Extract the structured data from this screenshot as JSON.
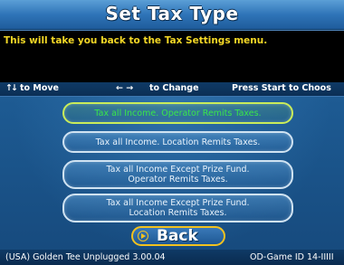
{
  "header": {
    "title": "Set Tax Type"
  },
  "message": "This will take you back to the Tax Settings menu.",
  "instructions": {
    "move_arrows": "↑↓",
    "move_label": "to Move",
    "change_arrows": "← →",
    "change_label": "to Change",
    "start_label": "Press Start to Choos"
  },
  "options": [
    {
      "line1": "Tax all Income. Operator Remits Taxes.",
      "line2": "",
      "selected": true
    },
    {
      "line1": "Tax all Income. Location Remits Taxes.",
      "line2": "",
      "selected": false
    },
    {
      "line1": "Tax all Income Except Prize Fund.",
      "line2": "Operator Remits Taxes.",
      "selected": false
    },
    {
      "line1": "Tax all Income Except Prize Fund.",
      "line2": "Location Remits Taxes.",
      "selected": false
    }
  ],
  "back_button": {
    "label": "Back",
    "icon": "play-circle-icon"
  },
  "footer": {
    "version": "(USA) Golden Tee Unplugged 3.00.04",
    "game_id": "OD-Game ID 14-IIIII"
  },
  "colors": {
    "message_text": "#f3d726",
    "selected_text": "#39e64a",
    "back_border": "#f2c21f",
    "background": "#1d5a92"
  }
}
